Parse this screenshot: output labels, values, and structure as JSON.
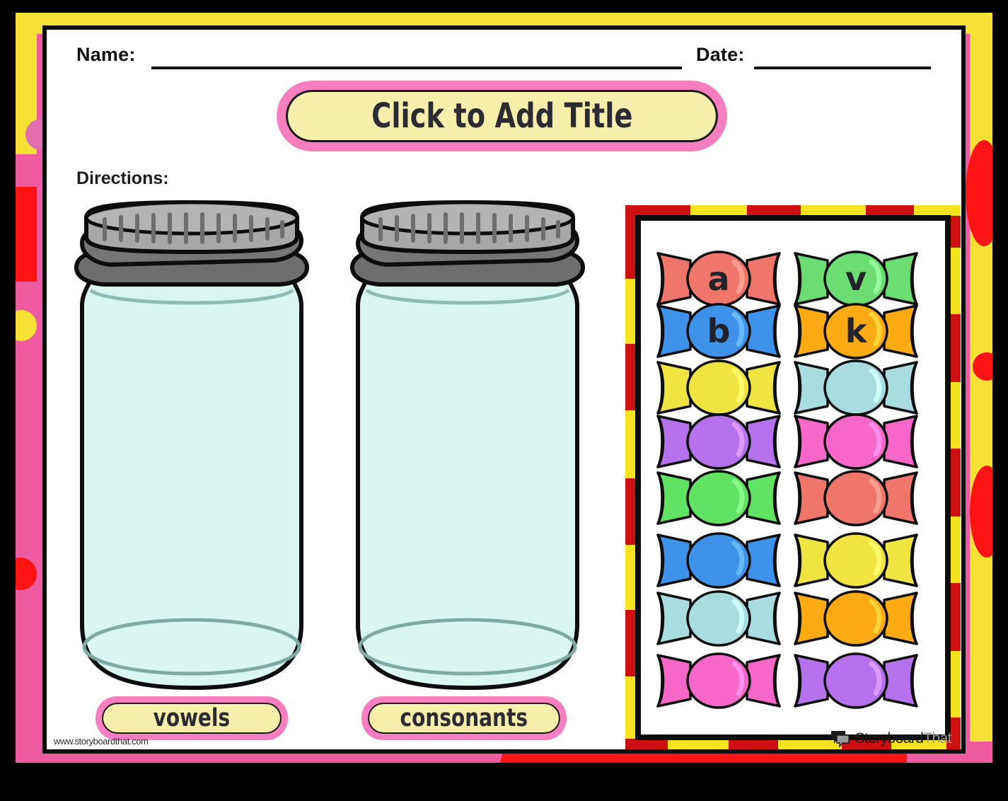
{
  "header": {
    "name_label": "Name:",
    "date_label": "Date:"
  },
  "title_banner": {
    "text": "Click to Add Title"
  },
  "directions": {
    "label": "Directions:"
  },
  "jars": [
    {
      "label": "vowels",
      "glass_color": "#d9f7f0",
      "lid_color": "#9a9a9a"
    },
    {
      "label": "consonants",
      "glass_color": "#d9f7f0",
      "lid_color": "#9a9a9a"
    }
  ],
  "candy_panel": {
    "frame_color": "#cf1010",
    "stripe_color": "#f5e320",
    "candies": [
      {
        "letter": "a",
        "color": "#f0766b",
        "row": 0,
        "col": 0
      },
      {
        "letter": "v",
        "color": "#6bdd72",
        "row": 0,
        "col": 1
      },
      {
        "letter": "b",
        "color": "#3f92ea",
        "row": 1,
        "col": 0
      },
      {
        "letter": "k",
        "color": "#f9ab11",
        "row": 1,
        "col": 1
      },
      {
        "letter": "",
        "color": "#f0e442",
        "row": 2,
        "col": 0
      },
      {
        "letter": "",
        "color": "#a8dce0",
        "row": 2,
        "col": 1
      },
      {
        "letter": "",
        "color": "#b473ec",
        "row": 3,
        "col": 0
      },
      {
        "letter": "",
        "color": "#f767c8",
        "row": 3,
        "col": 1
      },
      {
        "letter": "",
        "color": "#62e263",
        "row": 4,
        "col": 0
      },
      {
        "letter": "",
        "color": "#f0766b",
        "row": 4,
        "col": 1
      },
      {
        "letter": "",
        "color": "#3f92ea",
        "row": 5,
        "col": 0
      },
      {
        "letter": "",
        "color": "#f0e442",
        "row": 5,
        "col": 1
      },
      {
        "letter": "",
        "color": "#a8dce0",
        "row": 6,
        "col": 0
      },
      {
        "letter": "",
        "color": "#f9ab11",
        "row": 6,
        "col": 1
      },
      {
        "letter": "",
        "color": "#f767c8",
        "row": 7,
        "col": 0
      },
      {
        "letter": "",
        "color": "#b473ec",
        "row": 7,
        "col": 1
      }
    ]
  },
  "footer": {
    "watermark": "www.storyboardthat.com",
    "brand_primary": "Storyboard",
    "brand_secondary": "That"
  },
  "palette": {
    "pink": "#ef5ba1",
    "yellow": "#f7e135",
    "red": "#fa1414",
    "banner_pink": "#f77fc0",
    "banner_yellow": "#f7eeac",
    "ink": "#1d1d22"
  }
}
